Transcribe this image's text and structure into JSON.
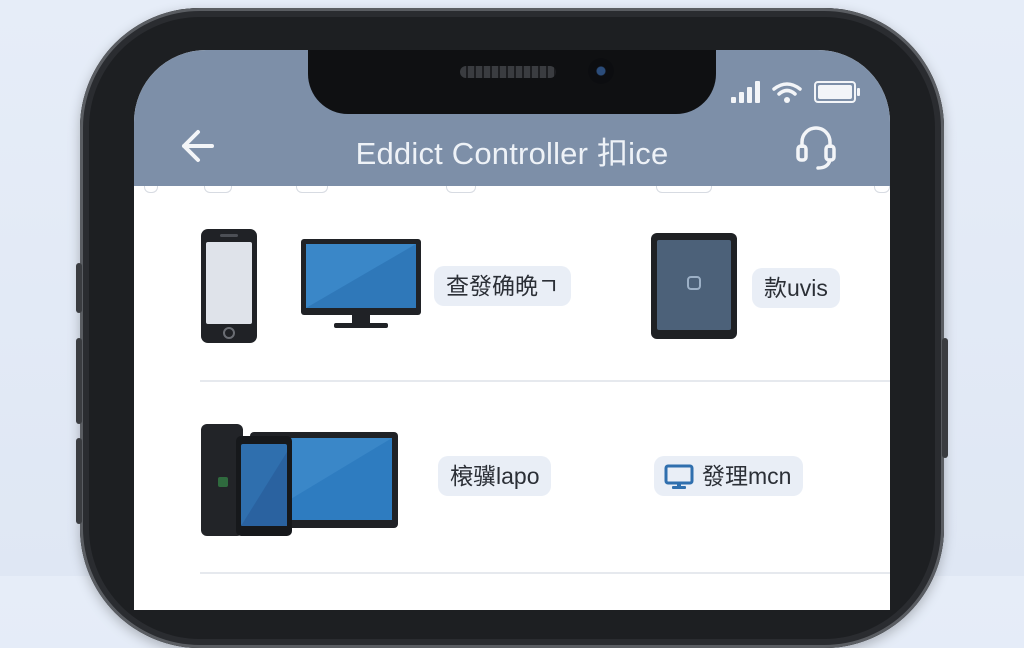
{
  "header": {
    "title": "Eddict Controller 扣ice",
    "back_icon": "back-arrow-icon",
    "support_icon": "headset-icon"
  },
  "status_bar": {
    "icons": [
      "signal-icon",
      "wifi-icon",
      "battery-icon"
    ]
  },
  "devices": [
    {
      "id": "phone-monitor",
      "label": "查發确晩ㄱ",
      "icons": [
        "smartphone-icon",
        "monitor-icon"
      ]
    },
    {
      "id": "tablet",
      "label": "款uvis",
      "icons": [
        "tablet-icon"
      ]
    },
    {
      "id": "multi-device",
      "label": "榱骥lapo",
      "icons": [
        "tablet-stack-icon"
      ]
    },
    {
      "id": "monitor",
      "label": "發理mcn",
      "icons": [
        "small-monitor-icon"
      ]
    }
  ],
  "colors": {
    "header_bg": "#7d8fa8",
    "chip_bg": "#e9eef6",
    "screen_blue": "#3a87c8"
  }
}
